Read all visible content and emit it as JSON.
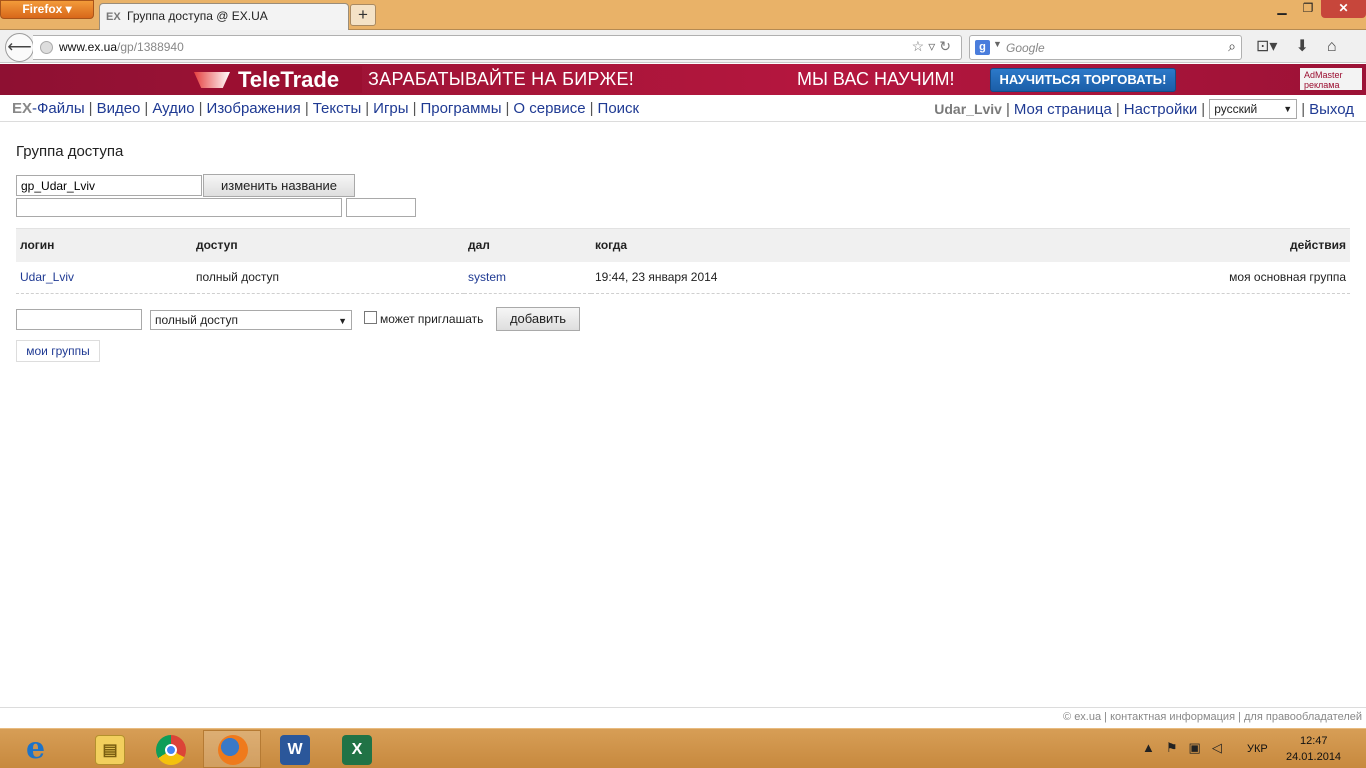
{
  "browser": {
    "firefox_button": "Firefox",
    "tab_icon": "EX",
    "tab_title": "Группа доступа @ EX.UA",
    "new_tab": "+",
    "url_host": "www.ex.ua",
    "url_path": "/gp/1388940",
    "search_placeholder": "Google"
  },
  "banner": {
    "logo": "TeleTrade",
    "text1": "ЗАРАБАТЫВАЙТЕ НА БИРЖЕ!",
    "text2": "МЫ ВАС НАУЧИМ!",
    "cta": "НАУЧИТЬСЯ ТОРГОВАТЬ!",
    "admaster_line1": "AdMaster",
    "admaster_line2": "реклама"
  },
  "sitenav": {
    "prefix": "EX",
    "items": [
      "-Файлы",
      "Видео",
      "Аудио",
      "Изображения",
      "Тексты",
      "Игры",
      "Программы",
      "О сервисе",
      "Поиск"
    ],
    "user": "Udar_Lviv",
    "my_page": "Моя страница",
    "settings": "Настройки",
    "language": "русский",
    "logout": "Выход"
  },
  "page": {
    "title": "Группа доступа",
    "group_name_value": "gp_Udar_Lviv",
    "rename_button": "изменить название"
  },
  "table": {
    "headers": {
      "login": "логин",
      "access": "доступ",
      "gave": "дал",
      "when": "когда",
      "actions": "действия"
    },
    "rows": [
      {
        "login": "Udar_Lviv",
        "access": "полный доступ",
        "gave": "system",
        "when": "19:44, 23 января 2014",
        "action": "моя основная группа"
      }
    ]
  },
  "add_form": {
    "access_selected": "полный доступ",
    "can_invite_label": "может приглашать",
    "can_invite_checked": false,
    "add_button": "добавить"
  },
  "my_groups_button": "мои группы",
  "footer": {
    "copyright": "© ex.ua",
    "contact": "контактная информация",
    "rights": "для правообладателей"
  },
  "taskbar": {
    "language": "УКР",
    "time": "12:47",
    "date": "24.01.2014"
  }
}
